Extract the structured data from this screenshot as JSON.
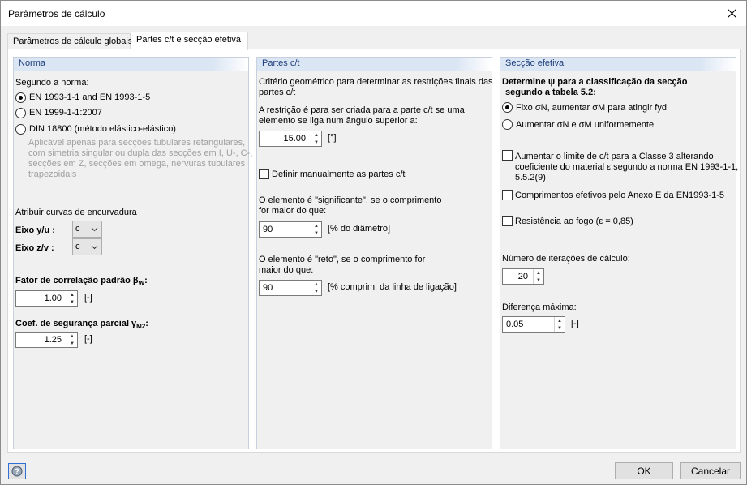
{
  "window": {
    "title": "Parâmetros de cálculo"
  },
  "tabs": [
    {
      "label": "Parâmetros de cálculo globais"
    },
    {
      "label": "Partes c/t e secção efetiva"
    }
  ],
  "norma": {
    "header": "Norma",
    "segundo_label": "Segundo a norma:",
    "options": [
      "EN 1993-1-1 and EN 1993-1-5",
      "EN 1999-1-1:2007",
      "DIN 18800 (método elástico-elástico)"
    ],
    "din_note": [
      "Aplicável apenas para secções tubulares retangulares,",
      "com simetria singular ou dupla das secções em I, U-, C-,",
      "secções em Z, secções em omega, nervuras tubulares",
      "trapezoidais"
    ],
    "curvas_label": "Atribuir curvas de encurvadura",
    "eixo_y_label": "Eixo y/u :",
    "eixo_y_value": "c",
    "eixo_z_label": "Eixo z/v :",
    "eixo_z_value": "c",
    "fator_label": "Fator de correlação padrão β",
    "fator_sub": "W",
    "fator_value": "1.00",
    "fator_unit": "[-]",
    "coef_label": "Coef. de segurança parcial γ",
    "coef_sub": "M2",
    "coef_value": "1.25",
    "coef_unit": "[-]"
  },
  "partes": {
    "header": "Partes c/t",
    "criterio": [
      "Critério geométrico para determinar as restrições finais das",
      "partes c/t"
    ],
    "restricao": [
      "A restrição é para ser criada para a parte c/t se uma",
      "elemento se liga num ângulo superior a:"
    ],
    "angle_value": "15.00",
    "angle_unit": "[°]",
    "definir_label": "Definir manualmente as partes c/t",
    "significante": [
      "O elemento é \"significante\", se o comprimento",
      "for maior do que:"
    ],
    "sig_value": "90",
    "sig_unit": "[% do diâmetro]",
    "reto": [
      "O elemento é \"reto\", se o comprimento for",
      "maior do que:"
    ],
    "reto_value": "90",
    "reto_unit": "[% comprim. da linha de ligação]"
  },
  "seccao": {
    "header": "Secção efetiva",
    "determine": [
      "Determine ψ para a classificação da secção",
      "segundo a tabela 5.2:"
    ],
    "fixo_label": "Fixo σN, aumentar σM para atingir fyd",
    "aumentar_label": "Aumentar σN e σM uniformemente",
    "aumentar_limite": [
      "Aumentar o limite de c/t para a Classe 3 alterando",
      "coeficiente do material ε segundo a norma EN 1993-1-1,",
      "5.5.2(9)"
    ],
    "comprimentos_label": "Comprimentos efetivos pelo Anexo E da EN1993-1-5",
    "resistencia_label": "Resistência ao fogo (ε = 0,85)",
    "iteracoes_label": "Número de iterações de cálculo:",
    "iteracoes_value": "20",
    "diferenca_label": "Diferença máxima:",
    "diferenca_value": "0.05",
    "diferenca_unit": "[-]"
  },
  "footer": {
    "ok": "OK",
    "cancel": "Cancelar"
  }
}
